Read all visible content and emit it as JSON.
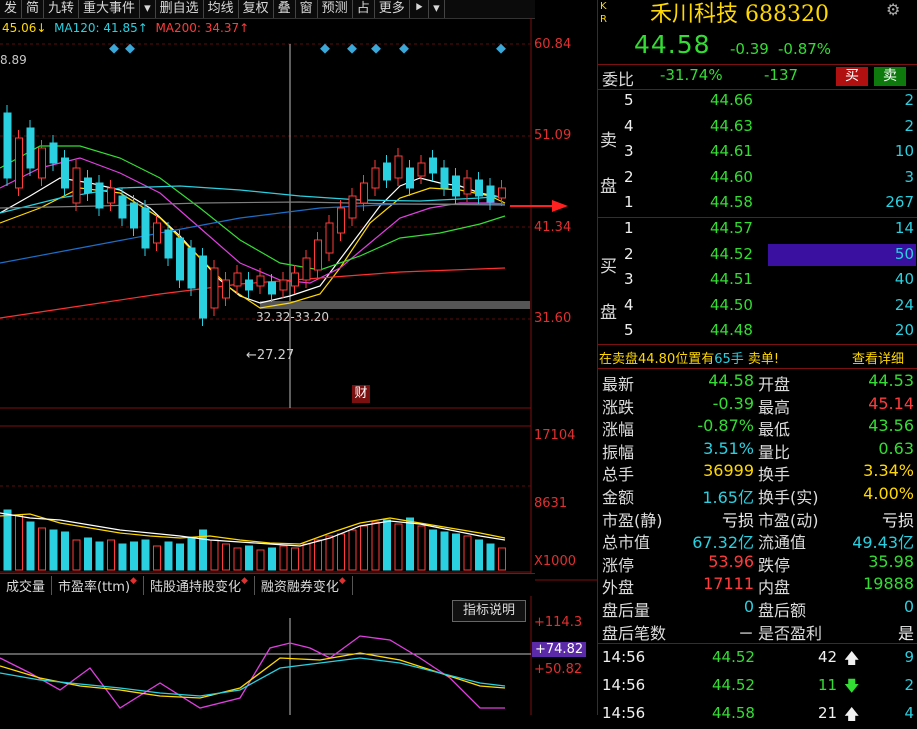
{
  "toolbar": {
    "items": [
      "发",
      "简",
      "九转",
      "重大事件",
      "▾",
      "删自选",
      "均线",
      "复权",
      "叠",
      "窗",
      "预测",
      "占",
      "更多",
      "⯈",
      "▾"
    ]
  },
  "legend": {
    "ma_short": "45.06↓",
    "ma120": "MA120: 41.85↑",
    "ma200": "MA200: 34.37↑",
    "left_value": "8.89"
  },
  "price_axis": [
    "60.84",
    "51.09",
    "41.34",
    "31.60"
  ],
  "volume_axis": [
    "17104",
    "8631",
    "X1000"
  ],
  "annotations": {
    "range_label": "32.32-33.20",
    "low_label": "←27.27",
    "fin_badge": "财"
  },
  "tabs": [
    {
      "label": "成交量",
      "dot": false
    },
    {
      "label": "市盈率(ttm)",
      "dot": true
    },
    {
      "label": "陆股通持股变化",
      "dot": true
    },
    {
      "label": "融资融券变化",
      "dot": true
    }
  ],
  "indicator": {
    "button": "指标说明",
    "axis": [
      "+114.3",
      "+74.82",
      "+50.82"
    ]
  },
  "stock": {
    "name": "禾川科技 688320",
    "kr_top": "K",
    "kr_bottom": "R",
    "price": "44.58",
    "change": "-0.39",
    "change_pct": "-0.87%",
    "wei_label": "委比",
    "wei_bi": "-31.74%",
    "wei_cha": "-137",
    "buy_btn": "买",
    "sell_btn": "卖"
  },
  "sell_label": [
    "卖",
    "盘"
  ],
  "buy_label": [
    "买",
    "盘"
  ],
  "asks": [
    {
      "level": "5",
      "price": "44.66",
      "vol": "2"
    },
    {
      "level": "4",
      "price": "44.63",
      "vol": "2"
    },
    {
      "level": "3",
      "price": "44.61",
      "vol": "10"
    },
    {
      "level": "2",
      "price": "44.60",
      "vol": "3"
    },
    {
      "level": "1",
      "price": "44.58",
      "vol": "267"
    }
  ],
  "bids": [
    {
      "level": "1",
      "price": "44.57",
      "vol": "14"
    },
    {
      "level": "2",
      "price": "44.52",
      "vol": "50"
    },
    {
      "level": "3",
      "price": "44.51",
      "vol": "40"
    },
    {
      "level": "4",
      "price": "44.50",
      "vol": "24"
    },
    {
      "level": "5",
      "price": "44.48",
      "vol": "20"
    }
  ],
  "notice": {
    "text_a": "在卖盘44.80位置有",
    "text_b": "65手",
    "text_c": "卖单!",
    "link": "查看详细"
  },
  "stats": [
    {
      "l1": "最新",
      "v1": "44.58",
      "c1": "grn",
      "l2": "开盘",
      "v2": "44.53",
      "c2": "grn"
    },
    {
      "l1": "涨跌",
      "v1": "-0.39",
      "c1": "grn",
      "l2": "最高",
      "v2": "45.14",
      "c2": "red"
    },
    {
      "l1": "涨幅",
      "v1": "-0.87%",
      "c1": "grn",
      "l2": "最低",
      "v2": "43.56",
      "c2": "grn"
    },
    {
      "l1": "振幅",
      "v1": "3.51%",
      "c1": "cyan",
      "l2": "量比",
      "v2": "0.63",
      "c2": "grn"
    },
    {
      "l1": "总手",
      "v1": "36999",
      "c1": "yel",
      "l2": "换手",
      "v2": "3.34%",
      "c2": "yel"
    },
    {
      "l1": "金额",
      "v1": "1.65亿",
      "c1": "cyan",
      "l2": "换手(实)",
      "v2": "4.00%",
      "c2": "yel"
    },
    {
      "l1": "市盈(静)",
      "v1": "亏损",
      "c1": "wht",
      "l2": "市盈(动)",
      "v2": "亏损",
      "c2": "wht"
    },
    {
      "l1": "总市值",
      "v1": "67.32亿",
      "c1": "cyan",
      "l2": "流通值",
      "v2": "49.43亿",
      "c2": "cyan"
    },
    {
      "l1": "涨停",
      "v1": "53.96",
      "c1": "red",
      "l2": "跌停",
      "v2": "35.98",
      "c2": "grn"
    },
    {
      "l1": "外盘",
      "v1": "17111",
      "c1": "red",
      "l2": "内盘",
      "v2": "19888",
      "c2": "grn"
    },
    {
      "l1": "盘后量",
      "v1": "0",
      "c1": "cyan",
      "l2": "盘后额",
      "v2": "0",
      "c2": "cyan"
    },
    {
      "l1": "盘后笔数",
      "v1": "－",
      "c1": "wht",
      "l2": "是否盈利",
      "v2": "是",
      "c2": "wht"
    }
  ],
  "ticks": [
    {
      "time": "14:56",
      "price": "44.52",
      "vol": "42",
      "dir": "up",
      "n": "9"
    },
    {
      "time": "14:56",
      "price": "44.52",
      "vol": "11",
      "dir": "down",
      "n": "2"
    },
    {
      "time": "14:56",
      "price": "44.58",
      "vol": "21",
      "dir": "up",
      "n": "4"
    }
  ],
  "colors": {
    "up": "#ff3b3b",
    "down": "#2ad0e0",
    "bg": "#000000",
    "frame": "#7a1010"
  }
}
